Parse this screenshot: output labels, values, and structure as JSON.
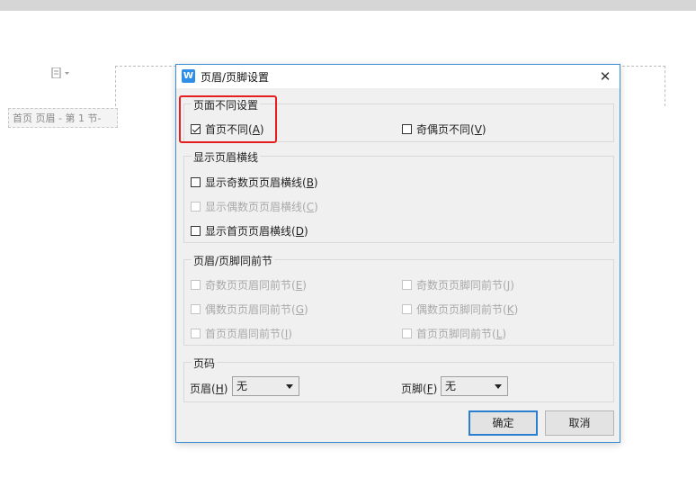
{
  "document": {
    "header_tag": "首页 页眉  - 第 1 节-"
  },
  "icons": {
    "doc_icon": "document-dropdown-icon",
    "app_logo": "wps-logo-icon",
    "close": "close-icon"
  },
  "dialog": {
    "title": "页眉/页脚设置",
    "logo_letter": "W",
    "close_glyph": "✕",
    "group_different": {
      "label": "页面不同设置",
      "first_page": {
        "text": "首页不同(",
        "key": "A",
        "suffix": ")",
        "checked": true
      },
      "odd_even": {
        "text": "奇偶页不同(",
        "key": "V",
        "suffix": ")",
        "checked": false
      }
    },
    "group_lines": {
      "label": "显示页眉横线",
      "odd": {
        "text": "显示奇数页页眉横线(",
        "key": "B",
        "suffix": ")"
      },
      "even": {
        "text": "显示偶数页页眉横线(",
        "key": "C",
        "suffix": ")"
      },
      "first": {
        "text": "显示首页页眉横线(",
        "key": "D",
        "suffix": ")"
      }
    },
    "group_same_prev": {
      "label": "页眉/页脚同前节",
      "odd_header": {
        "text": "奇数页页眉同前节(",
        "key": "E",
        "suffix": ")"
      },
      "even_header": {
        "text": "偶数页页眉同前节(",
        "key": "G",
        "suffix": ")"
      },
      "first_header": {
        "text": "首页页眉同前节(",
        "key": "I",
        "suffix": ")"
      },
      "odd_footer": {
        "text": "奇数页页脚同前节(",
        "key": "J",
        "suffix": ")"
      },
      "even_footer": {
        "text": "偶数页页脚同前节(",
        "key": "K",
        "suffix": ")"
      },
      "first_footer": {
        "text": "首页页脚同前节(",
        "key": "L",
        "suffix": ")"
      }
    },
    "group_page_number": {
      "label": "页码",
      "header": {
        "text": "页眉(",
        "key": "H",
        "suffix": ")",
        "value": "无"
      },
      "footer": {
        "text": "页脚(",
        "key": "F",
        "suffix": ")",
        "value": "无"
      }
    },
    "ok_label": "确定",
    "cancel_label": "取消"
  },
  "colors": {
    "highlight": "#e51f1f",
    "dialog_border": "#3c8fd6",
    "primary_button_border": "#2a7fd0"
  }
}
